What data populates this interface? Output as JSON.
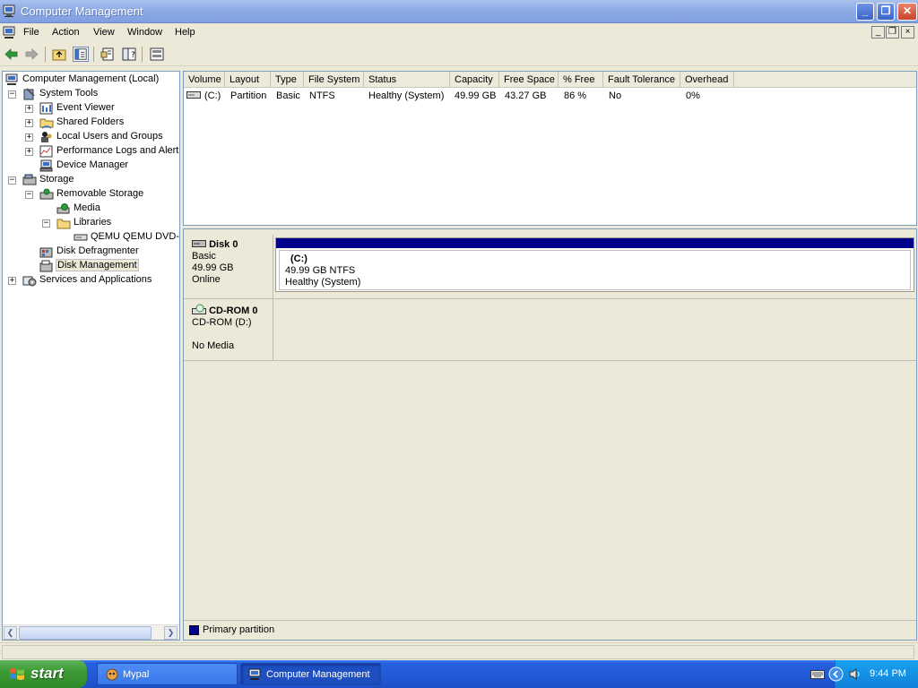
{
  "window": {
    "title": "Computer Management",
    "buttons": {
      "minimize": "_",
      "restore": "❐",
      "close": "✕"
    }
  },
  "menu": {
    "items": [
      "File",
      "Action",
      "View",
      "Window",
      "Help"
    ],
    "mdi": {
      "minimize": "_",
      "restore": "❐",
      "close": "×"
    }
  },
  "tree": {
    "items": [
      {
        "label": "Computer Management (Local)",
        "expander": ""
      },
      {
        "label": "System Tools",
        "expander": "−"
      },
      {
        "label": "Event Viewer",
        "expander": "+"
      },
      {
        "label": "Shared Folders",
        "expander": "+"
      },
      {
        "label": "Local Users and Groups",
        "expander": "+"
      },
      {
        "label": "Performance Logs and Alerts",
        "expander": "+"
      },
      {
        "label": "Device Manager",
        "expander": ""
      },
      {
        "label": "Storage",
        "expander": "−"
      },
      {
        "label": "Removable Storage",
        "expander": "−"
      },
      {
        "label": "Media",
        "expander": ""
      },
      {
        "label": "Libraries",
        "expander": "−"
      },
      {
        "label": "QEMU QEMU DVD-ROM",
        "expander": ""
      },
      {
        "label": "Disk Defragmenter",
        "expander": ""
      },
      {
        "label": "Disk Management",
        "expander": ""
      },
      {
        "label": "Services and Applications",
        "expander": "+"
      }
    ],
    "scroll": {
      "left": "❮",
      "right": "❯"
    }
  },
  "volumes": {
    "columns": [
      "Volume",
      "Layout",
      "Type",
      "File System",
      "Status",
      "Capacity",
      "Free Space",
      "% Free",
      "Fault Tolerance",
      "Overhead"
    ],
    "rows": [
      [
        "(C:)",
        "Partition",
        "Basic",
        "NTFS",
        "Healthy (System)",
        "49.99 GB",
        "43.27 GB",
        "86 %",
        "No",
        "0%"
      ]
    ]
  },
  "disks": {
    "disk0": {
      "name": "Disk 0",
      "type": "Basic",
      "size": "49.99 GB",
      "state": "Online",
      "partition": {
        "label": "(C:)",
        "detail": "49.99 GB NTFS",
        "status": "Healthy (System)"
      }
    },
    "cdrom0": {
      "name": "CD-ROM 0",
      "type": "CD-ROM (D:)",
      "state": "No Media"
    }
  },
  "legend": {
    "primary_partition": "Primary partition",
    "primary_color": "#00008b"
  },
  "taskbar": {
    "start": "start",
    "tasks": [
      "Mypal",
      "Computer Management"
    ],
    "clock": "9:44 PM"
  },
  "colors": {
    "titlebar": "#8fabe4",
    "taskbar": "#225ad8",
    "start_button": "#3c9a36",
    "tray": "#1181d9"
  }
}
